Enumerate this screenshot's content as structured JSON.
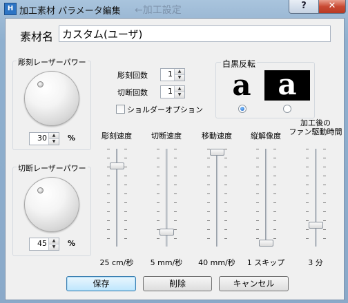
{
  "window": {
    "title": "加工素材 パラメータ編集",
    "background_title": "←加工設定",
    "help_label": "?",
    "close_label": "✕",
    "app_icon_label": "H"
  },
  "material": {
    "label": "素材名",
    "value": "カスタム(ユーザ)"
  },
  "engrave_power": {
    "title": "彫刻レーザーパワー",
    "value": "30",
    "unit": "%"
  },
  "cut_power": {
    "title": "切断レーザーパワー",
    "value": "45",
    "unit": "%"
  },
  "counts": {
    "engrave_label": "彫刻回数",
    "engrave_value": "1",
    "cut_label": "切断回数",
    "cut_value": "1",
    "shoulder_label": "ショルダーオプション",
    "shoulder_checked": false
  },
  "invert": {
    "title": "白黒反転",
    "glyph_normal": "a",
    "glyph_inverted": "a",
    "selected": "normal"
  },
  "sliders": [
    {
      "label": "彫刻速度",
      "value_text": "25 cm/秒",
      "level": 0.85
    },
    {
      "label": "切断速度",
      "value_text": "5 mm/秒",
      "level": 0.12
    },
    {
      "label": "移動速度",
      "value_text": "40 mm/秒",
      "level": 1.0
    },
    {
      "label": "縦解像度",
      "value_text": "1 スキップ",
      "level": 0.0
    },
    {
      "label": "加工後の\nファン駆動時間",
      "value_text": "3 分",
      "level": 0.2
    }
  ],
  "buttons": {
    "save": "保存",
    "delete": "削除",
    "cancel": "キャンセル"
  },
  "colors": {
    "title_blue": "#9bb8d4",
    "close_red": "#c94a33",
    "radio_blue": "#1d63c2"
  }
}
